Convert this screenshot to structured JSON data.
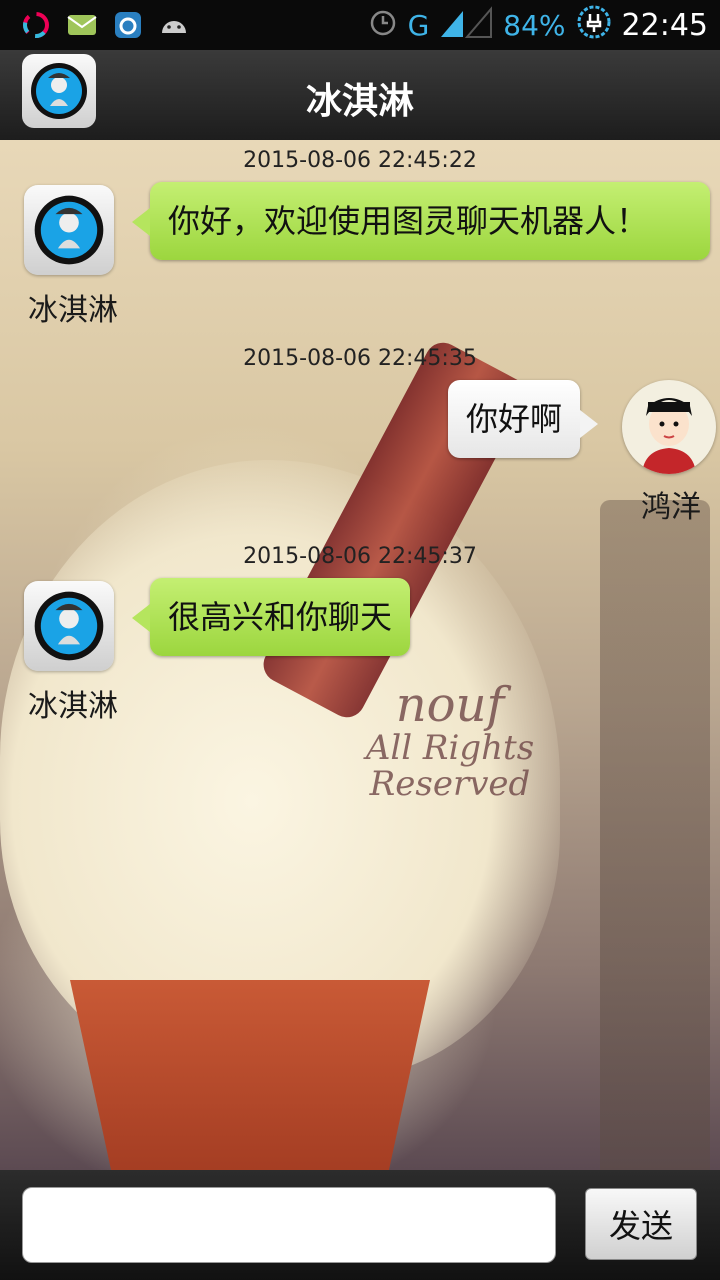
{
  "status_bar": {
    "battery_percent": "84%",
    "time": "22:45",
    "network": "G",
    "icons": [
      "swirl-app-icon",
      "mail-icon",
      "camera-app-icon",
      "android-icon",
      "alarm-icon",
      "signal-icon",
      "battery-charging-icon"
    ]
  },
  "header": {
    "title": "冰淇淋",
    "avatar_icon": "robot-avatar-icon"
  },
  "background": {
    "watermark_line1": "nouf",
    "watermark_line2": "All Rights Reserved"
  },
  "messages": [
    {
      "timestamp": "2015-08-06 22:45:22",
      "sender": "冰淇淋",
      "side": "left",
      "text": "你好，欢迎使用图灵聊天机器人！"
    },
    {
      "timestamp": "2015-08-06 22:45:35",
      "sender": "鸿洋",
      "side": "right",
      "text": "你好啊"
    },
    {
      "timestamp": "2015-08-06 22:45:37",
      "sender": "冰淇淋",
      "side": "left",
      "text": "很高兴和你聊天"
    }
  ],
  "input_bar": {
    "value": "",
    "send_label": "发送"
  },
  "colors": {
    "bot_bubble": "#a8dd4a",
    "user_bubble": "#f2f2f2",
    "accent": "#3fb4e8"
  }
}
